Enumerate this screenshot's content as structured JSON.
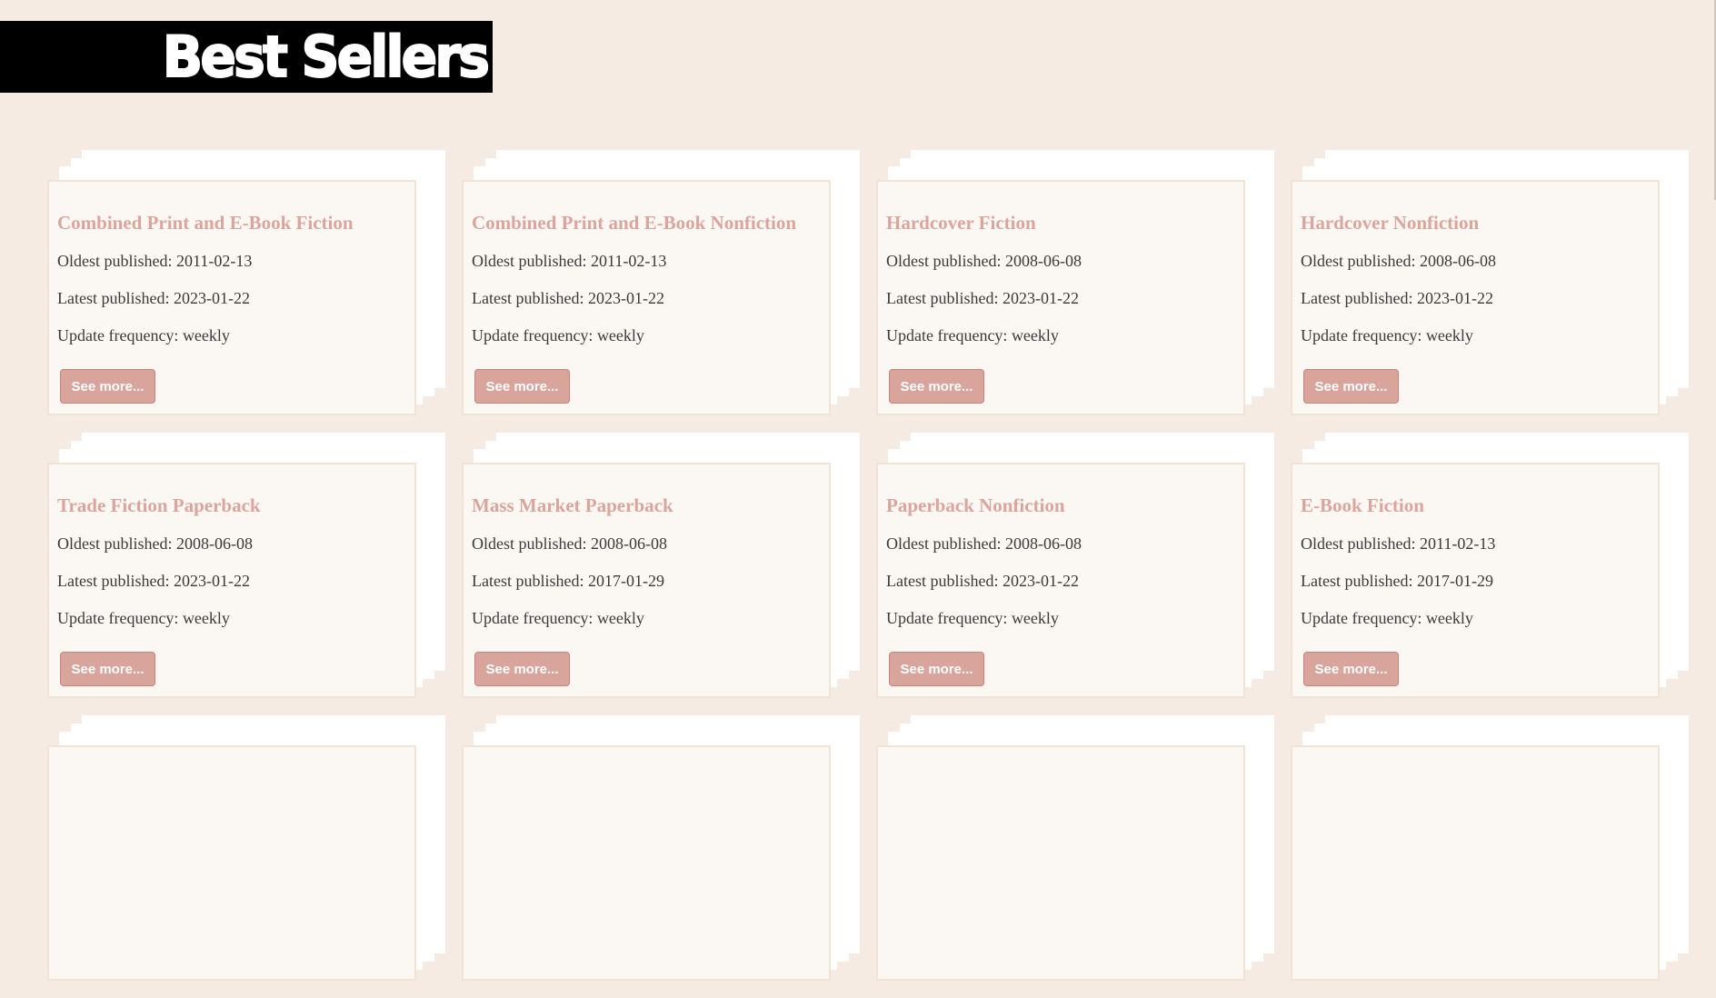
{
  "header": {
    "title": "Best Sellers"
  },
  "lists": [
    {
      "name": "Combined Print and E-Book Fiction",
      "oldest_label": "Oldest published:",
      "oldest": "2011-02-13",
      "latest_label": "Latest published:",
      "latest": "2023-01-22",
      "frequency_label": "Update frequency:",
      "frequency": "weekly",
      "button": "See more..."
    },
    {
      "name": "Combined Print and E-Book Nonfiction",
      "oldest_label": "Oldest published:",
      "oldest": "2011-02-13",
      "latest_label": "Latest published:",
      "latest": "2023-01-22",
      "frequency_label": "Update frequency:",
      "frequency": "weekly",
      "button": "See more..."
    },
    {
      "name": "Hardcover Fiction",
      "oldest_label": "Oldest published:",
      "oldest": "2008-06-08",
      "latest_label": "Latest published:",
      "latest": "2023-01-22",
      "frequency_label": "Update frequency:",
      "frequency": "weekly",
      "button": "See more..."
    },
    {
      "name": "Hardcover Nonfiction",
      "oldest_label": "Oldest published:",
      "oldest": "2008-06-08",
      "latest_label": "Latest published:",
      "latest": "2023-01-22",
      "frequency_label": "Update frequency:",
      "frequency": "weekly",
      "button": "See more..."
    },
    {
      "name": "Trade Fiction Paperback",
      "oldest_label": "Oldest published:",
      "oldest": "2008-06-08",
      "latest_label": "Latest published:",
      "latest": "2023-01-22",
      "frequency_label": "Update frequency:",
      "frequency": "weekly",
      "button": "See more..."
    },
    {
      "name": "Mass Market Paperback",
      "oldest_label": "Oldest published:",
      "oldest": "2008-06-08",
      "latest_label": "Latest published:",
      "latest": "2017-01-29",
      "frequency_label": "Update frequency:",
      "frequency": "weekly",
      "button": "See more..."
    },
    {
      "name": "Paperback Nonfiction",
      "oldest_label": "Oldest published:",
      "oldest": "2008-06-08",
      "latest_label": "Latest published:",
      "latest": "2023-01-22",
      "frequency_label": "Update frequency:",
      "frequency": "weekly",
      "button": "See more..."
    },
    {
      "name": "E-Book Fiction",
      "oldest_label": "Oldest published:",
      "oldest": "2011-02-13",
      "latest_label": "Latest published:",
      "latest": "2017-01-29",
      "frequency_label": "Update frequency:",
      "frequency": "weekly",
      "button": "See more..."
    }
  ],
  "colors": {
    "page_background": "#f5ebe2",
    "banner_background": "#000000",
    "card_title": "#dba59c",
    "button_background": "#d9a49b",
    "body_text": "#3a3a3a"
  }
}
